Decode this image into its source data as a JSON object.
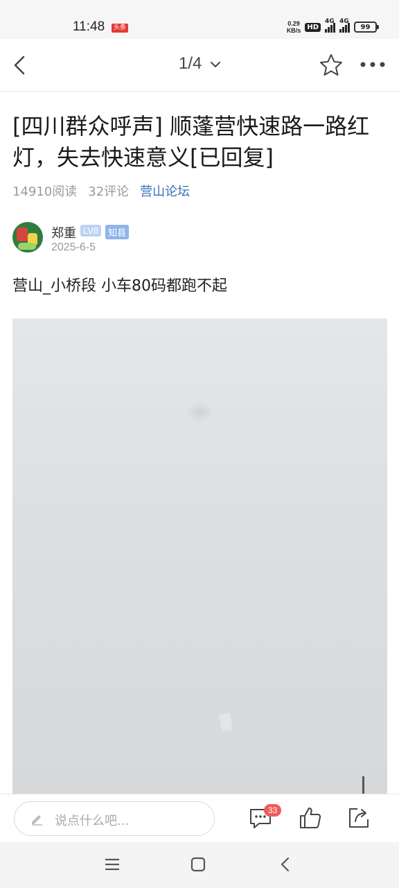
{
  "status_bar": {
    "time": "11:48",
    "app_badge": "头条",
    "net_speed_value": "0.29",
    "net_speed_unit": "KB/s",
    "hd_label": "HD",
    "signal1_label": "4G",
    "signal2_label": "4G",
    "battery": "99"
  },
  "nav": {
    "page_indicator": "1/4"
  },
  "article": {
    "title": "[四川群众呼声] 顺蓬营快速路一路红灯，失去快速意义[已回复]",
    "reads": "14910阅读",
    "comments": "32评论",
    "forum": "营山论坛",
    "author": {
      "name": "郑重",
      "level": "LV8",
      "tag": "知县",
      "date": "2025-6-5"
    },
    "body": "营山_小桥段 小车80码都跑不起"
  },
  "action_bar": {
    "comment_placeholder": "说点什么吧...",
    "comment_count": "33"
  }
}
